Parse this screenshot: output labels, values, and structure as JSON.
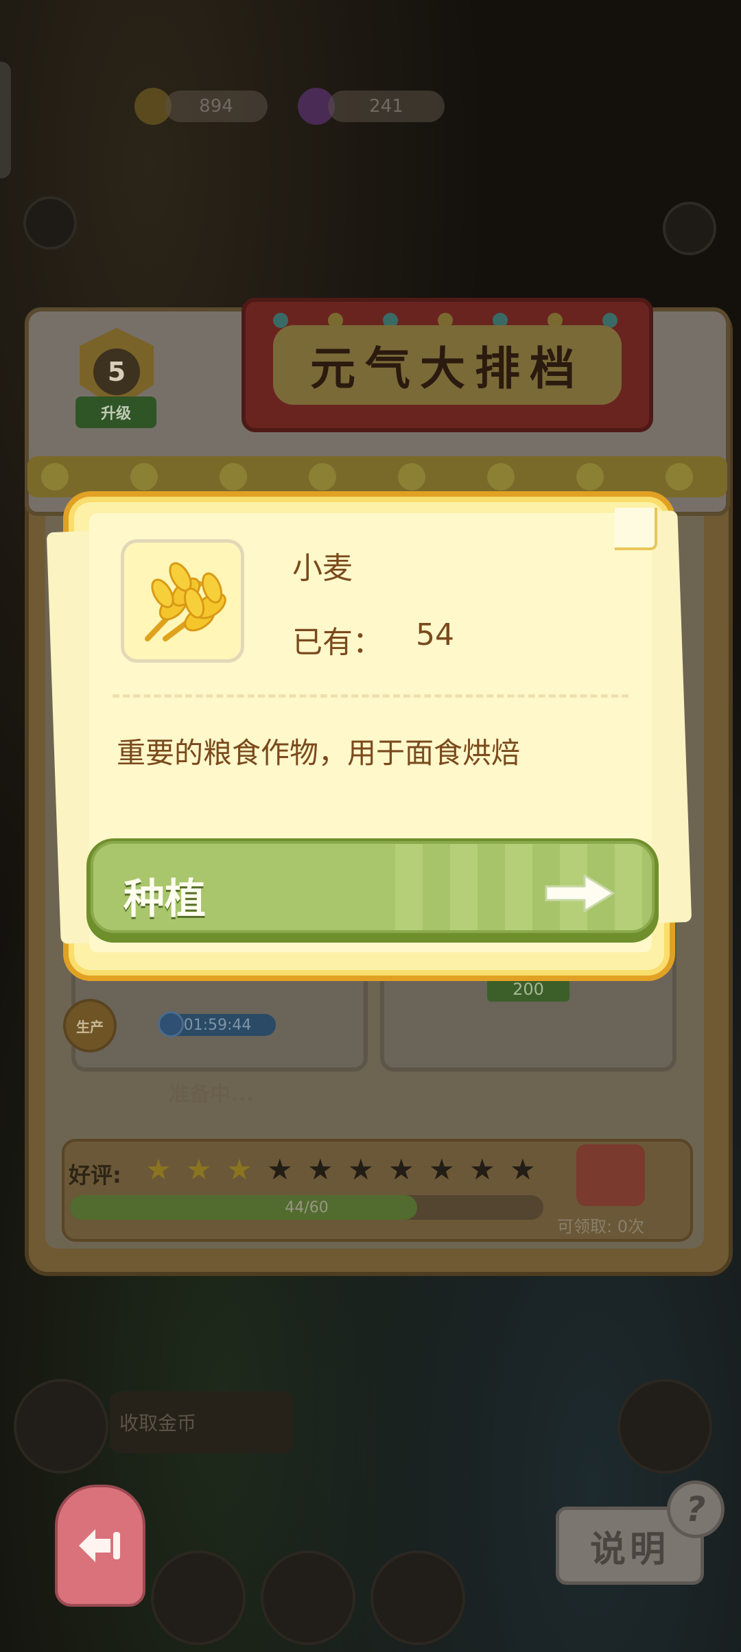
{
  "hud": {
    "coins": "894",
    "gems": "241"
  },
  "stall": {
    "sign_title": "元气大排档",
    "level": "5",
    "upgrade_label": "升级",
    "production_badge": "生产",
    "timer": "01:59:44",
    "price": "200",
    "ready_status": "准备中...",
    "rating_label": "好评:",
    "stars_filled": 3,
    "stars_total": 10,
    "progress_text": "44/60",
    "progress_value": 44,
    "progress_max": 60,
    "claimable_label": "可领取: 0次"
  },
  "bottom": {
    "task_text": "收取金币",
    "help_label": "说明",
    "help_q": "?"
  },
  "modal": {
    "item_name": "小麦",
    "owned_label": "已有：",
    "owned_value": "54",
    "description": "重要的粮食作物，用于面食烘焙",
    "plant_button_label": "种植"
  },
  "colors": {
    "modal_border": "#e1a124",
    "modal_bg": "#fdf1a8",
    "text_brown": "#7a4a1c",
    "button_green": "#a7c46a"
  },
  "icons": [
    "wheat-icon",
    "arrow-right-icon",
    "back-arrow-icon",
    "gift-icon",
    "clock-icon",
    "star-icon"
  ]
}
